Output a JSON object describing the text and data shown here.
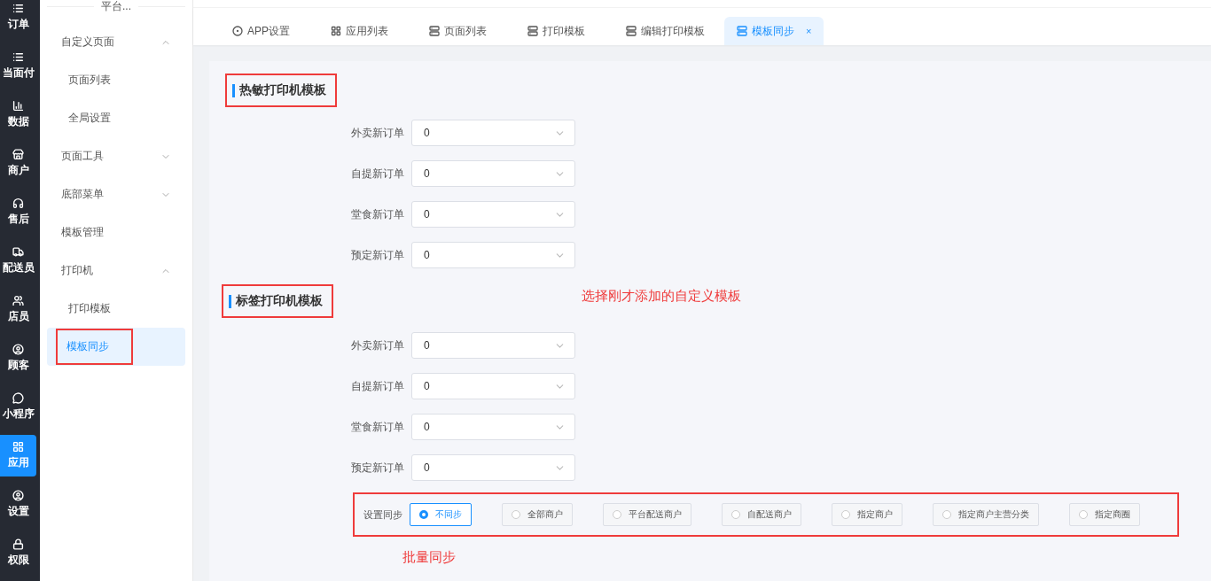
{
  "nav": [
    {
      "label": "订单",
      "selected": false
    },
    {
      "label": "当面付",
      "selected": false
    },
    {
      "label": "数据",
      "selected": false
    },
    {
      "label": "商户",
      "selected": false
    },
    {
      "label": "售后",
      "selected": false
    },
    {
      "label": "配送员",
      "selected": false
    },
    {
      "label": "店员",
      "selected": false
    },
    {
      "label": "顾客",
      "selected": false
    },
    {
      "label": "小程序",
      "selected": false
    },
    {
      "label": "应用",
      "selected": true
    },
    {
      "label": "设置",
      "selected": false
    },
    {
      "label": "权限",
      "selected": false
    }
  ],
  "sidebar": {
    "title": "平台...",
    "items": [
      {
        "label": "自定义页面",
        "expanded": true,
        "children": [
          {
            "label": "页面列表",
            "selected": false,
            "annotated": false
          },
          {
            "label": "全局设置",
            "selected": false,
            "annotated": false
          }
        ]
      },
      {
        "label": "页面工具",
        "expanded": false
      },
      {
        "label": "底部菜单",
        "expanded": false
      },
      {
        "label": "模板管理"
      },
      {
        "label": "打印机",
        "expanded": true,
        "children": [
          {
            "label": "打印模板",
            "selected": false,
            "annotated": false
          },
          {
            "label": "模板同步",
            "selected": true,
            "annotated": true
          }
        ]
      }
    ]
  },
  "tabs": [
    {
      "label": "APP设置",
      "selected": false
    },
    {
      "label": "应用列表",
      "selected": false
    },
    {
      "label": "页面列表",
      "selected": false
    },
    {
      "label": "打印模板",
      "selected": false
    },
    {
      "label": "编辑打印模板",
      "selected": false
    },
    {
      "label": "模板同步",
      "selected": true,
      "close": "×"
    }
  ],
  "sections": [
    {
      "title": "热敏打印机模板",
      "annotated": true,
      "fields": [
        {
          "label": "外卖新订单",
          "value": "0"
        },
        {
          "label": "自提新订单",
          "value": "0"
        },
        {
          "label": "堂食新订单",
          "value": "0"
        },
        {
          "label": "预定新订单",
          "value": "0"
        }
      ]
    },
    {
      "title": "标签打印机模板",
      "annotated": true,
      "note": "选择刚才添加的自定义模板",
      "fields": [
        {
          "label": "外卖新订单",
          "value": "0"
        },
        {
          "label": "自提新订单",
          "value": "0"
        },
        {
          "label": "堂食新订单",
          "value": "0"
        },
        {
          "label": "预定新订单",
          "value": "0"
        }
      ]
    }
  ],
  "sync": {
    "label": "设置同步",
    "annotated": true,
    "note": "批量同步",
    "options": [
      {
        "label": "不同步",
        "selected": true
      },
      {
        "label": "全部商户",
        "selected": false
      },
      {
        "label": "平台配送商户",
        "selected": false
      },
      {
        "label": "自配送商户",
        "selected": false
      },
      {
        "label": "指定商户",
        "selected": false
      },
      {
        "label": "指定商户主营分类",
        "selected": false
      },
      {
        "label": "指定商圈",
        "selected": false
      }
    ]
  }
}
